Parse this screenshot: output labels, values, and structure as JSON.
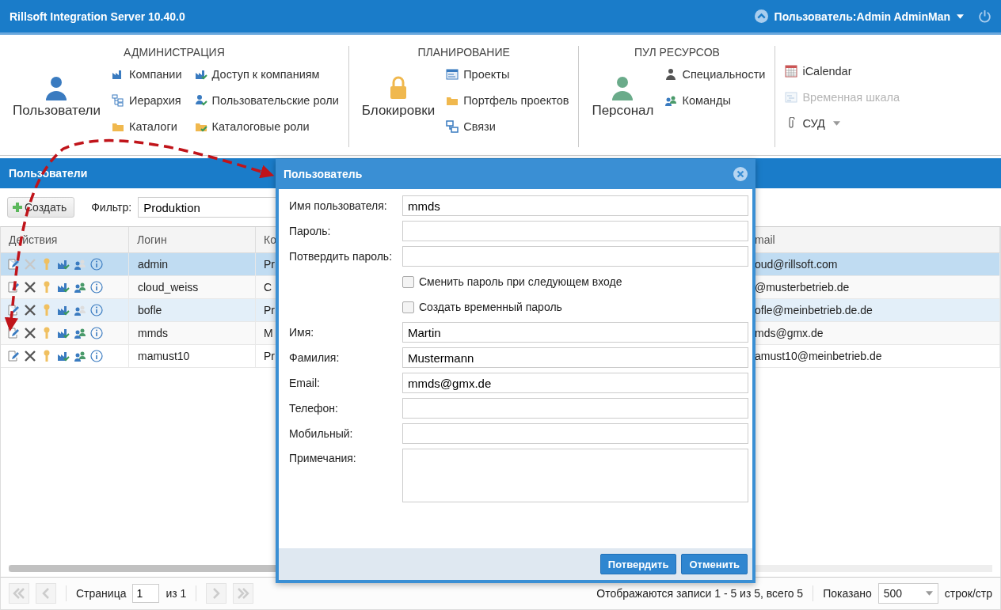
{
  "app_title": "Rillsoft Integration Server 10.40.0",
  "user_menu": {
    "label": "Пользователь:Admin AdminMan"
  },
  "ribbon": {
    "groups": [
      {
        "title": "АДМИНИСТРАЦИЯ",
        "large": {
          "label": "Пользователи"
        },
        "items": [
          {
            "label": "Компании",
            "disabled": false
          },
          {
            "label": "Иерархия",
            "disabled": false
          },
          {
            "label": "Каталоги",
            "disabled": false
          },
          {
            "label": "Доступ к компаниям",
            "disabled": false
          },
          {
            "label": "Пользовательские роли",
            "disabled": false
          },
          {
            "label": "Каталоговые роли",
            "disabled": false
          }
        ]
      },
      {
        "title": "ПЛАНИРОВАНИЕ",
        "large": {
          "label": "Блокировки"
        },
        "items": [
          {
            "label": "Проекты",
            "disabled": false
          },
          {
            "label": "Портфель проектов",
            "disabled": false
          },
          {
            "label": "Связи",
            "disabled": false
          }
        ]
      },
      {
        "title": "ПУЛ РЕСУРСОВ",
        "large": {
          "label": "Персонал"
        },
        "items": [
          {
            "label": "Специальности",
            "disabled": false
          },
          {
            "label": "Команды",
            "disabled": false
          }
        ]
      },
      {
        "items": [
          {
            "label": "iCalendar",
            "disabled": false
          },
          {
            "label": "Временная шкала",
            "disabled": true
          },
          {
            "label": "СУД",
            "disabled": false,
            "dropdown": true
          }
        ]
      }
    ]
  },
  "panel": {
    "title": "Пользователи",
    "create_button": "Создать",
    "filter_label": "Фильтр:",
    "filter_value": "Produktion"
  },
  "table": {
    "columns": [
      "Действия",
      "Логин",
      "Ко",
      "mail"
    ],
    "rows": [
      {
        "login": "admin",
        "column_3": "Pr",
        "email": "oud@rillsoft.com",
        "selected": true,
        "highlighted": false,
        "delete_disabled": true,
        "teams_disabled": true
      },
      {
        "login": "cloud_weiss",
        "column_3": "C",
        "email": "@musterbetrieb.de",
        "selected": false,
        "highlighted": false,
        "delete_disabled": false,
        "teams_disabled": false
      },
      {
        "login": "bofle",
        "column_3": "Pr",
        "email": "ofle@meinbetrieb.de.de",
        "selected": false,
        "highlighted": true,
        "delete_disabled": false,
        "teams_disabled": true
      },
      {
        "login": "mmds",
        "column_3": "M",
        "email": "mds@gmx.de",
        "selected": false,
        "highlighted": false,
        "delete_disabled": false,
        "teams_disabled": false
      },
      {
        "login": "mamust10",
        "column_3": "Pr",
        "email": "amust10@meinbetrieb.de",
        "selected": false,
        "highlighted": false,
        "delete_disabled": false,
        "teams_disabled": false
      }
    ]
  },
  "pager": {
    "page_label": "Страница",
    "page": "1",
    "of": "из 1",
    "info": "Отображаются записи 1 - 5 из 5, всего 5",
    "shown_label": "Показано",
    "page_size": "500",
    "per_page": "строк/стр"
  },
  "dialog": {
    "title": "Пользователь",
    "fields": [
      {
        "kind": "text",
        "label": "Имя пользователя:",
        "value": "mmds"
      },
      {
        "kind": "text",
        "label": "Пароль:"
      },
      {
        "kind": "text",
        "label": "Потвердить пароль:"
      },
      {
        "kind": "checkbox",
        "label": "Сменить пароль при следующем входе",
        "checked": false
      },
      {
        "kind": "checkbox",
        "label": "Создать временный пароль",
        "checked": false
      },
      {
        "kind": "text",
        "label": "Имя:",
        "value": "Martin"
      },
      {
        "kind": "text",
        "label": "Фамилия:",
        "value": "Mustermann"
      },
      {
        "kind": "text",
        "label": "Email:",
        "value": "mmds@gmx.de"
      },
      {
        "kind": "text",
        "label": "Телефон:"
      },
      {
        "kind": "text",
        "label": "Мобильный:"
      },
      {
        "kind": "textarea",
        "label": "Примечания:"
      }
    ],
    "buttons": [
      "Потвердить",
      "Отменить"
    ]
  }
}
